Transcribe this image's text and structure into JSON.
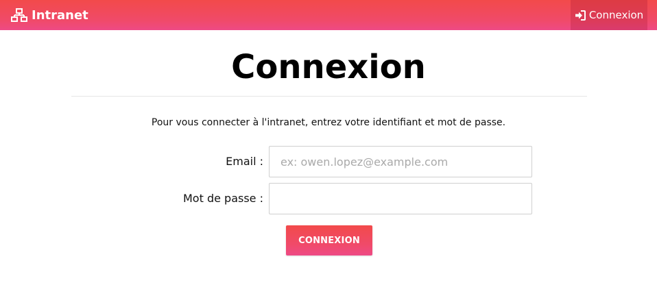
{
  "navbar": {
    "brand_label": "Intranet",
    "brand_icon": "network-icon",
    "login_label": "Connexion",
    "login_icon": "sign-in-icon"
  },
  "main": {
    "title": "Connexion",
    "intro": "Pour vous connecter à l'intranet, entrez votre identifiant et mot de passe.",
    "email_label": "Email :",
    "email_placeholder": "ex: owen.lopez@example.com",
    "email_value": "",
    "password_label": "Mot de passe :",
    "password_value": "",
    "submit_label": "CONNEXION"
  },
  "colors": {
    "accent_top": "#f24a4a",
    "accent_bottom": "#ee4a86"
  }
}
